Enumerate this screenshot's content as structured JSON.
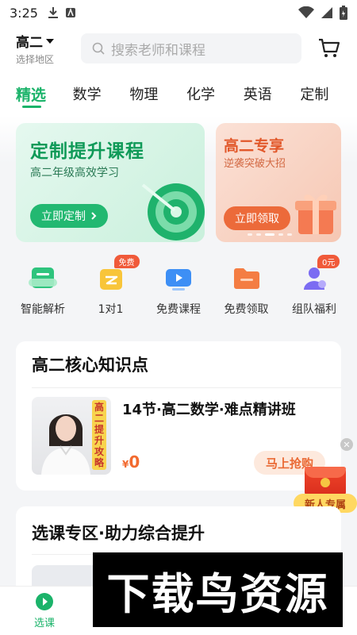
{
  "status_bar": {
    "time": "3:25"
  },
  "header": {
    "grade": "高二",
    "region": "选择地区",
    "search_placeholder": "搜索老师和课程"
  },
  "tabs": [
    "精选",
    "数学",
    "物理",
    "化学",
    "英语",
    "定制"
  ],
  "active_tab": "精选",
  "banners": {
    "main": {
      "title": "定制提升课程",
      "subtitle": "高二年级高效学习",
      "button": "立即定制"
    },
    "side": {
      "title": "高二专享",
      "subtitle": "逆袭突破大招",
      "button": "立即领取"
    }
  },
  "quick_links": [
    {
      "label": "智能解析",
      "icon": "analysis-icon",
      "badge": ""
    },
    {
      "label": "1对1",
      "icon": "one-on-one-icon",
      "badge": "免费"
    },
    {
      "label": "免费课程",
      "icon": "video-icon",
      "badge": ""
    },
    {
      "label": "免费领取",
      "icon": "folder-icon",
      "badge": ""
    },
    {
      "label": "组队福利",
      "icon": "team-icon",
      "badge": "0元"
    }
  ],
  "section1": {
    "title": "高二核心知识点",
    "course": {
      "title": "14节·高二数学·难点精讲班",
      "thumb_tag": "高二提升攻略",
      "currency": "¥",
      "price": "0",
      "button": "马上抢购"
    }
  },
  "float_promo": {
    "label": "新人专属"
  },
  "section2": {
    "title": "选课专区·助力综合提升"
  },
  "bottom_nav": {
    "active_label": "选课"
  },
  "watermark": "下载鸟资源",
  "colors": {
    "accent": "#1bb36a",
    "orange": "#f26a2f"
  }
}
